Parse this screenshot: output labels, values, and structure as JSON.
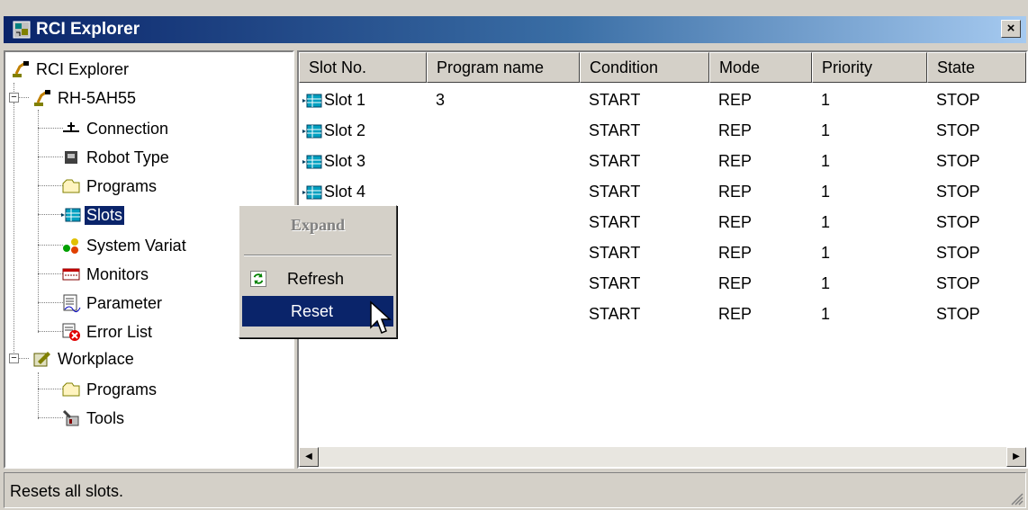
{
  "window": {
    "title": "RCI Explorer",
    "close_label": "×",
    "title_icon": "rci-explorer-icon"
  },
  "tree": {
    "root": "RCI Explorer",
    "robot": "RH-5AH55",
    "robot_children": [
      "Connection",
      "Robot Type",
      "Programs",
      "Slots",
      "System Variat",
      "Monitors",
      "Parameter",
      "Error List"
    ],
    "workplace": "Workplace",
    "workplace_children": [
      "Programs",
      "Tools"
    ],
    "selected": "Slots"
  },
  "list": {
    "columns": [
      "Slot No.",
      "Program name",
      "Condition",
      "Mode",
      "Priority",
      "State"
    ],
    "rows": [
      {
        "slot": "Slot 1",
        "program": "3",
        "condition": "START",
        "mode": "REP",
        "priority": "1",
        "state": "STOP"
      },
      {
        "slot": "Slot 2",
        "program": "",
        "condition": "START",
        "mode": "REP",
        "priority": "1",
        "state": "STOP"
      },
      {
        "slot": "Slot 3",
        "program": "",
        "condition": "START",
        "mode": "REP",
        "priority": "1",
        "state": "STOP"
      },
      {
        "slot": "Slot 4",
        "program": "",
        "condition": "START",
        "mode": "REP",
        "priority": "1",
        "state": "STOP"
      },
      {
        "slot": "",
        "program": "",
        "condition": "START",
        "mode": "REP",
        "priority": "1",
        "state": "STOP"
      },
      {
        "slot": "",
        "program": "",
        "condition": "START",
        "mode": "REP",
        "priority": "1",
        "state": "STOP"
      },
      {
        "slot": "",
        "program": "",
        "condition": "START",
        "mode": "REP",
        "priority": "1",
        "state": "STOP"
      },
      {
        "slot": "",
        "program": "",
        "condition": "START",
        "mode": "REP",
        "priority": "1",
        "state": "STOP"
      }
    ]
  },
  "context_menu": {
    "expand": "Expand",
    "refresh": "Refresh",
    "reset": "Reset",
    "highlighted": "Reset"
  },
  "status": {
    "text": "Resets all slots."
  },
  "colors": {
    "title_start": "#0a246a",
    "title_end": "#a6caf0",
    "selection": "#0a246a",
    "face": "#d4d0c8"
  }
}
